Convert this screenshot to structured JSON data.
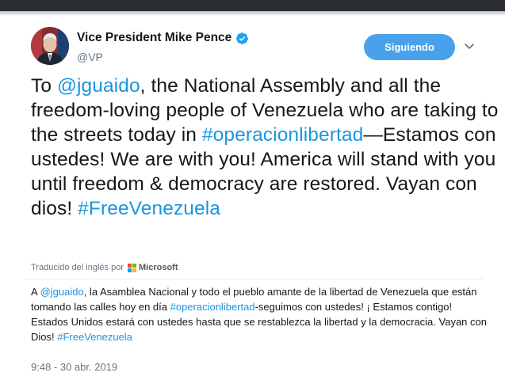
{
  "user": {
    "display_name": "Vice President Mike Pence",
    "handle": "@VP"
  },
  "follow_button": {
    "label": "Siguiendo"
  },
  "tweet": {
    "segments": [
      {
        "text": "To ",
        "type": "text"
      },
      {
        "text": "@jguaido",
        "type": "link"
      },
      {
        "text": ", the National Assembly and all the freedom-loving people of Venezuela who are taking to the streets today in ",
        "type": "text"
      },
      {
        "text": "#operacionlibertad",
        "type": "link"
      },
      {
        "text": "—Estamos con ustedes! We are with you! America will stand with you until freedom & democracy are restored. Vayan con dios! ",
        "type": "text"
      },
      {
        "text": "#FreeVenezuela",
        "type": "link"
      }
    ]
  },
  "translation": {
    "label": "Traducido del inglés por",
    "provider": "Microsoft",
    "segments": [
      {
        "text": "A ",
        "type": "text"
      },
      {
        "text": "@jguaido",
        "type": "link"
      },
      {
        "text": ", la Asamblea Nacional y todo el pueblo amante de la libertad de Venezuela que están tomando las calles hoy en día ",
        "type": "text"
      },
      {
        "text": "#operacionlibertad",
        "type": "link"
      },
      {
        "text": "-seguimos con ustedes! ¡ Estamos contigo! Estados Unidos estará con ustedes hasta que se restablezca la libertad y la democracia. Vayan con Dios! ",
        "type": "text"
      },
      {
        "text": "#FreeVenezuela",
        "type": "link"
      }
    ]
  },
  "timestamp": "9:48 - 30 abr. 2019",
  "colors": {
    "link": "#1b95e0",
    "follow_button_bg": "#4aa1eb",
    "verified_badge": "#1da1f2",
    "muted_text": "#657786",
    "microsoft": [
      "#f25022",
      "#7fba00",
      "#00a4ef",
      "#ffb900"
    ]
  },
  "icons": {
    "verified": "verified-badge-icon",
    "caret": "chevron-down-icon",
    "provider_logo": "microsoft-logo"
  }
}
